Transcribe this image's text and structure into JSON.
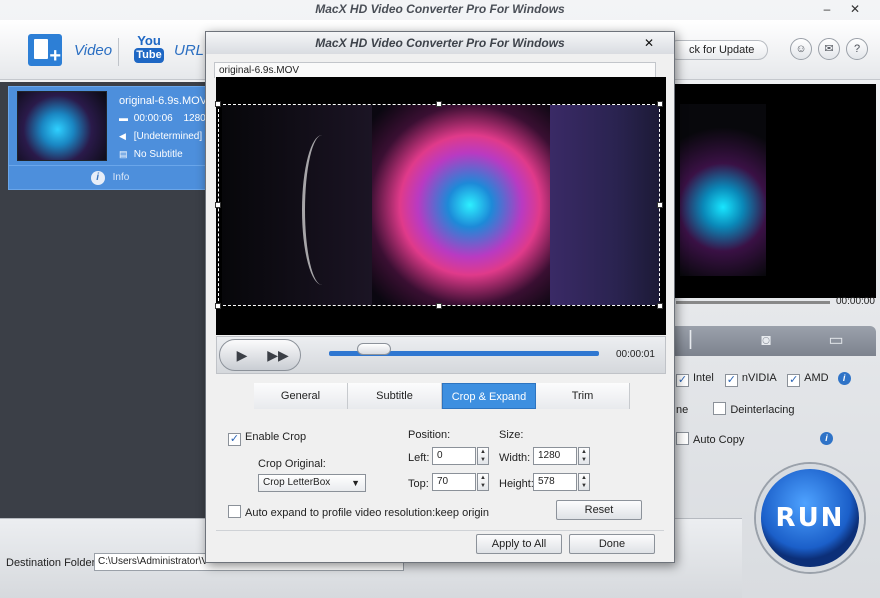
{
  "main": {
    "title": "MacX HD Video Converter Pro For Windows",
    "toolbar": {
      "video_label": "Video",
      "youtube_you": "You",
      "youtube_tube": "Tube",
      "url_label": "URL",
      "check_update": "ck for Update"
    },
    "file": {
      "name": "original-6.9s.MOV",
      "duration": "00:00:06",
      "resolution": "1280",
      "audio": "[Undetermined]",
      "subtitle": "No Subtitle",
      "info_label": "Info"
    },
    "preview_time": "00:00:00",
    "hardware": {
      "intel": "Intel",
      "nvidia": "nVIDIA",
      "amd": "AMD"
    },
    "options": {
      "partial_label": "ne",
      "deinterlacing": "Deinterlacing",
      "auto_copy": "Auto Copy"
    },
    "run_label": "RUN",
    "destination": {
      "label": "Destination Folder:",
      "value": "C:\\Users\\Administrator\\V"
    }
  },
  "dialog": {
    "title": "MacX HD Video Converter Pro For Windows",
    "file_tab": "original-6.9s.MOV",
    "time": "00:00:01",
    "seek_progress": 0.0,
    "tabs": [
      "General",
      "Subtitle",
      "Crop & Expand",
      "Trim"
    ],
    "active_tab": "Crop & Expand",
    "enable_crop_label": "Enable Crop",
    "enable_crop_checked": true,
    "crop_original_label": "Crop Original:",
    "crop_original_value": "Crop LetterBox",
    "position_label": "Position:",
    "left_label": "Left:",
    "left_value": "0",
    "top_label": "Top:",
    "top_value": "70",
    "size_label": "Size:",
    "width_label": "Width:",
    "width_value": "1280",
    "height_label": "Height:",
    "height_value": "578",
    "auto_expand_label": "Auto expand to profile video resolution:keep origin",
    "auto_expand_checked": false,
    "reset_label": "Reset",
    "apply_all_label": "Apply to All",
    "done_label": "Done"
  },
  "colors": {
    "accent": "#3d8fe0",
    "file_item_bg": "#4d8fdc",
    "run_button": "#1b5fc9"
  },
  "icons": [
    "add-video-icon",
    "youtube-icon",
    "account-icon",
    "mail-icon",
    "help-icon",
    "info-icon",
    "play-icon",
    "fast-forward-icon",
    "camera-icon",
    "folder-icon",
    "close-icon",
    "minimize-icon"
  ]
}
